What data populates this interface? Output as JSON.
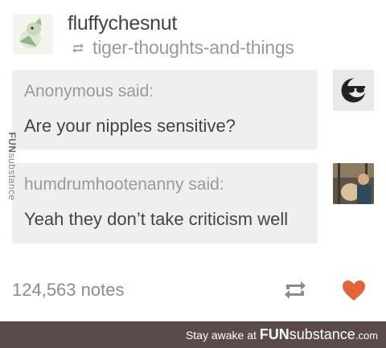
{
  "post": {
    "username": "fluffychesnut",
    "reblog_source": "tiger-thoughts-and-things",
    "ask": {
      "asker": "Anonymous",
      "said": "said:",
      "question": "Are your nipples sensitive?"
    },
    "reply": {
      "asker": "humdrumhootenanny",
      "said": "said:",
      "text": "Yeah they don’t take criticism well"
    },
    "notes": "124,563 notes"
  },
  "watermark": {
    "brand_bold": "FUN",
    "brand_rest": "substance"
  },
  "footer": {
    "prefix": "Stay awake at ",
    "brand_bold": "FUN",
    "brand_rest": "substance",
    "domain": ".com"
  },
  "icons": [
    "retweet-icon",
    "reblog-icon",
    "heart-icon",
    "sunglasses-avatar-icon"
  ],
  "colors": {
    "heart": "#e4643a",
    "footer_bg": "#5a4b4a",
    "bubble_bg": "#efefef"
  }
}
